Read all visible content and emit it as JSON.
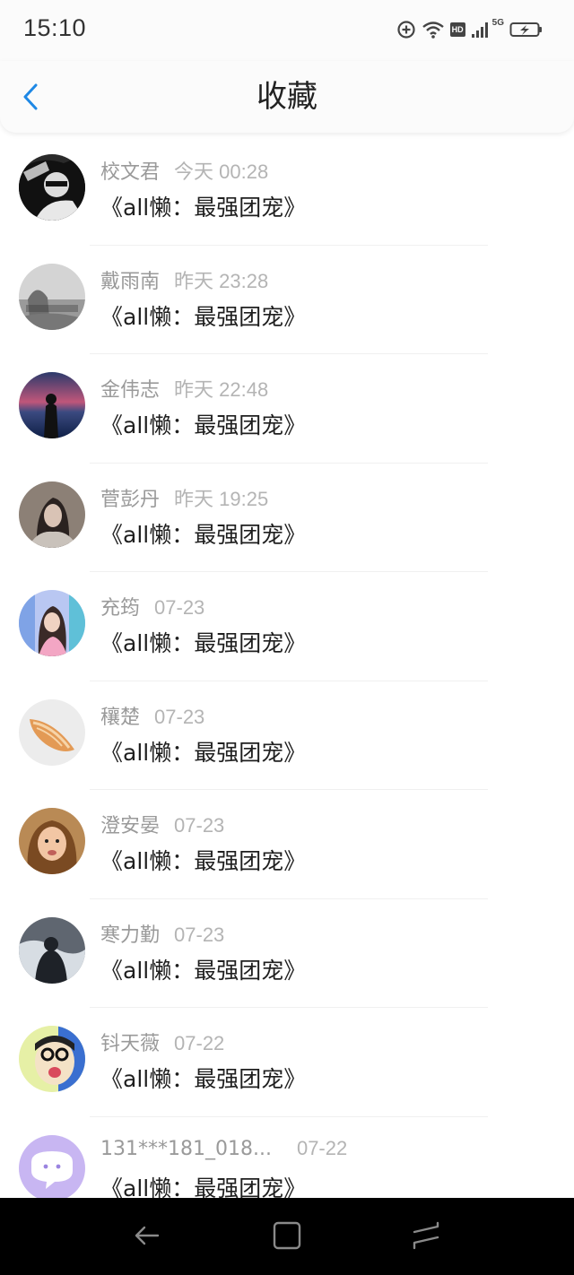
{
  "status": {
    "time": "15:10",
    "hd_label": "HD",
    "network": "5G"
  },
  "header": {
    "title": "收藏"
  },
  "items": [
    {
      "name": "校文君",
      "time": "今天 00:28",
      "text": "《all懒：最强团宠》",
      "avatar": "bw-boy-sunglasses"
    },
    {
      "name": "戴雨南",
      "time": "昨天 23:28",
      "text": "《all懒：最强团宠》",
      "avatar": "gray-text-photo"
    },
    {
      "name": "金伟志",
      "time": "昨天 22:48",
      "text": "《all懒：最强团宠》",
      "avatar": "sunset-silhouette"
    },
    {
      "name": "菅彭丹",
      "time": "昨天 19:25",
      "text": "《all懒：最强团宠》",
      "avatar": "girl-dark-hair"
    },
    {
      "name": "充筠",
      "time": "07-23",
      "text": "《all懒：最强团宠》",
      "avatar": "colorful-girl"
    },
    {
      "name": "穰楚",
      "time": "07-23",
      "text": "《all懒：最强团宠》",
      "avatar": "seashell"
    },
    {
      "name": "澄安晏",
      "time": "07-23",
      "text": "《all懒：最强团宠》",
      "avatar": "child-portrait"
    },
    {
      "name": "寒力勤",
      "time": "07-23",
      "text": "《all懒：最强团宠》",
      "avatar": "dark-figure"
    },
    {
      "name": "钭天薇",
      "time": "07-22",
      "text": "《all懒：最强团宠》",
      "avatar": "cartoon-glasses"
    },
    {
      "name": "131***181_018...",
      "time": "07-22",
      "text": "《all懒：最强团宠》",
      "avatar": "purple-chat-bubble"
    }
  ]
}
